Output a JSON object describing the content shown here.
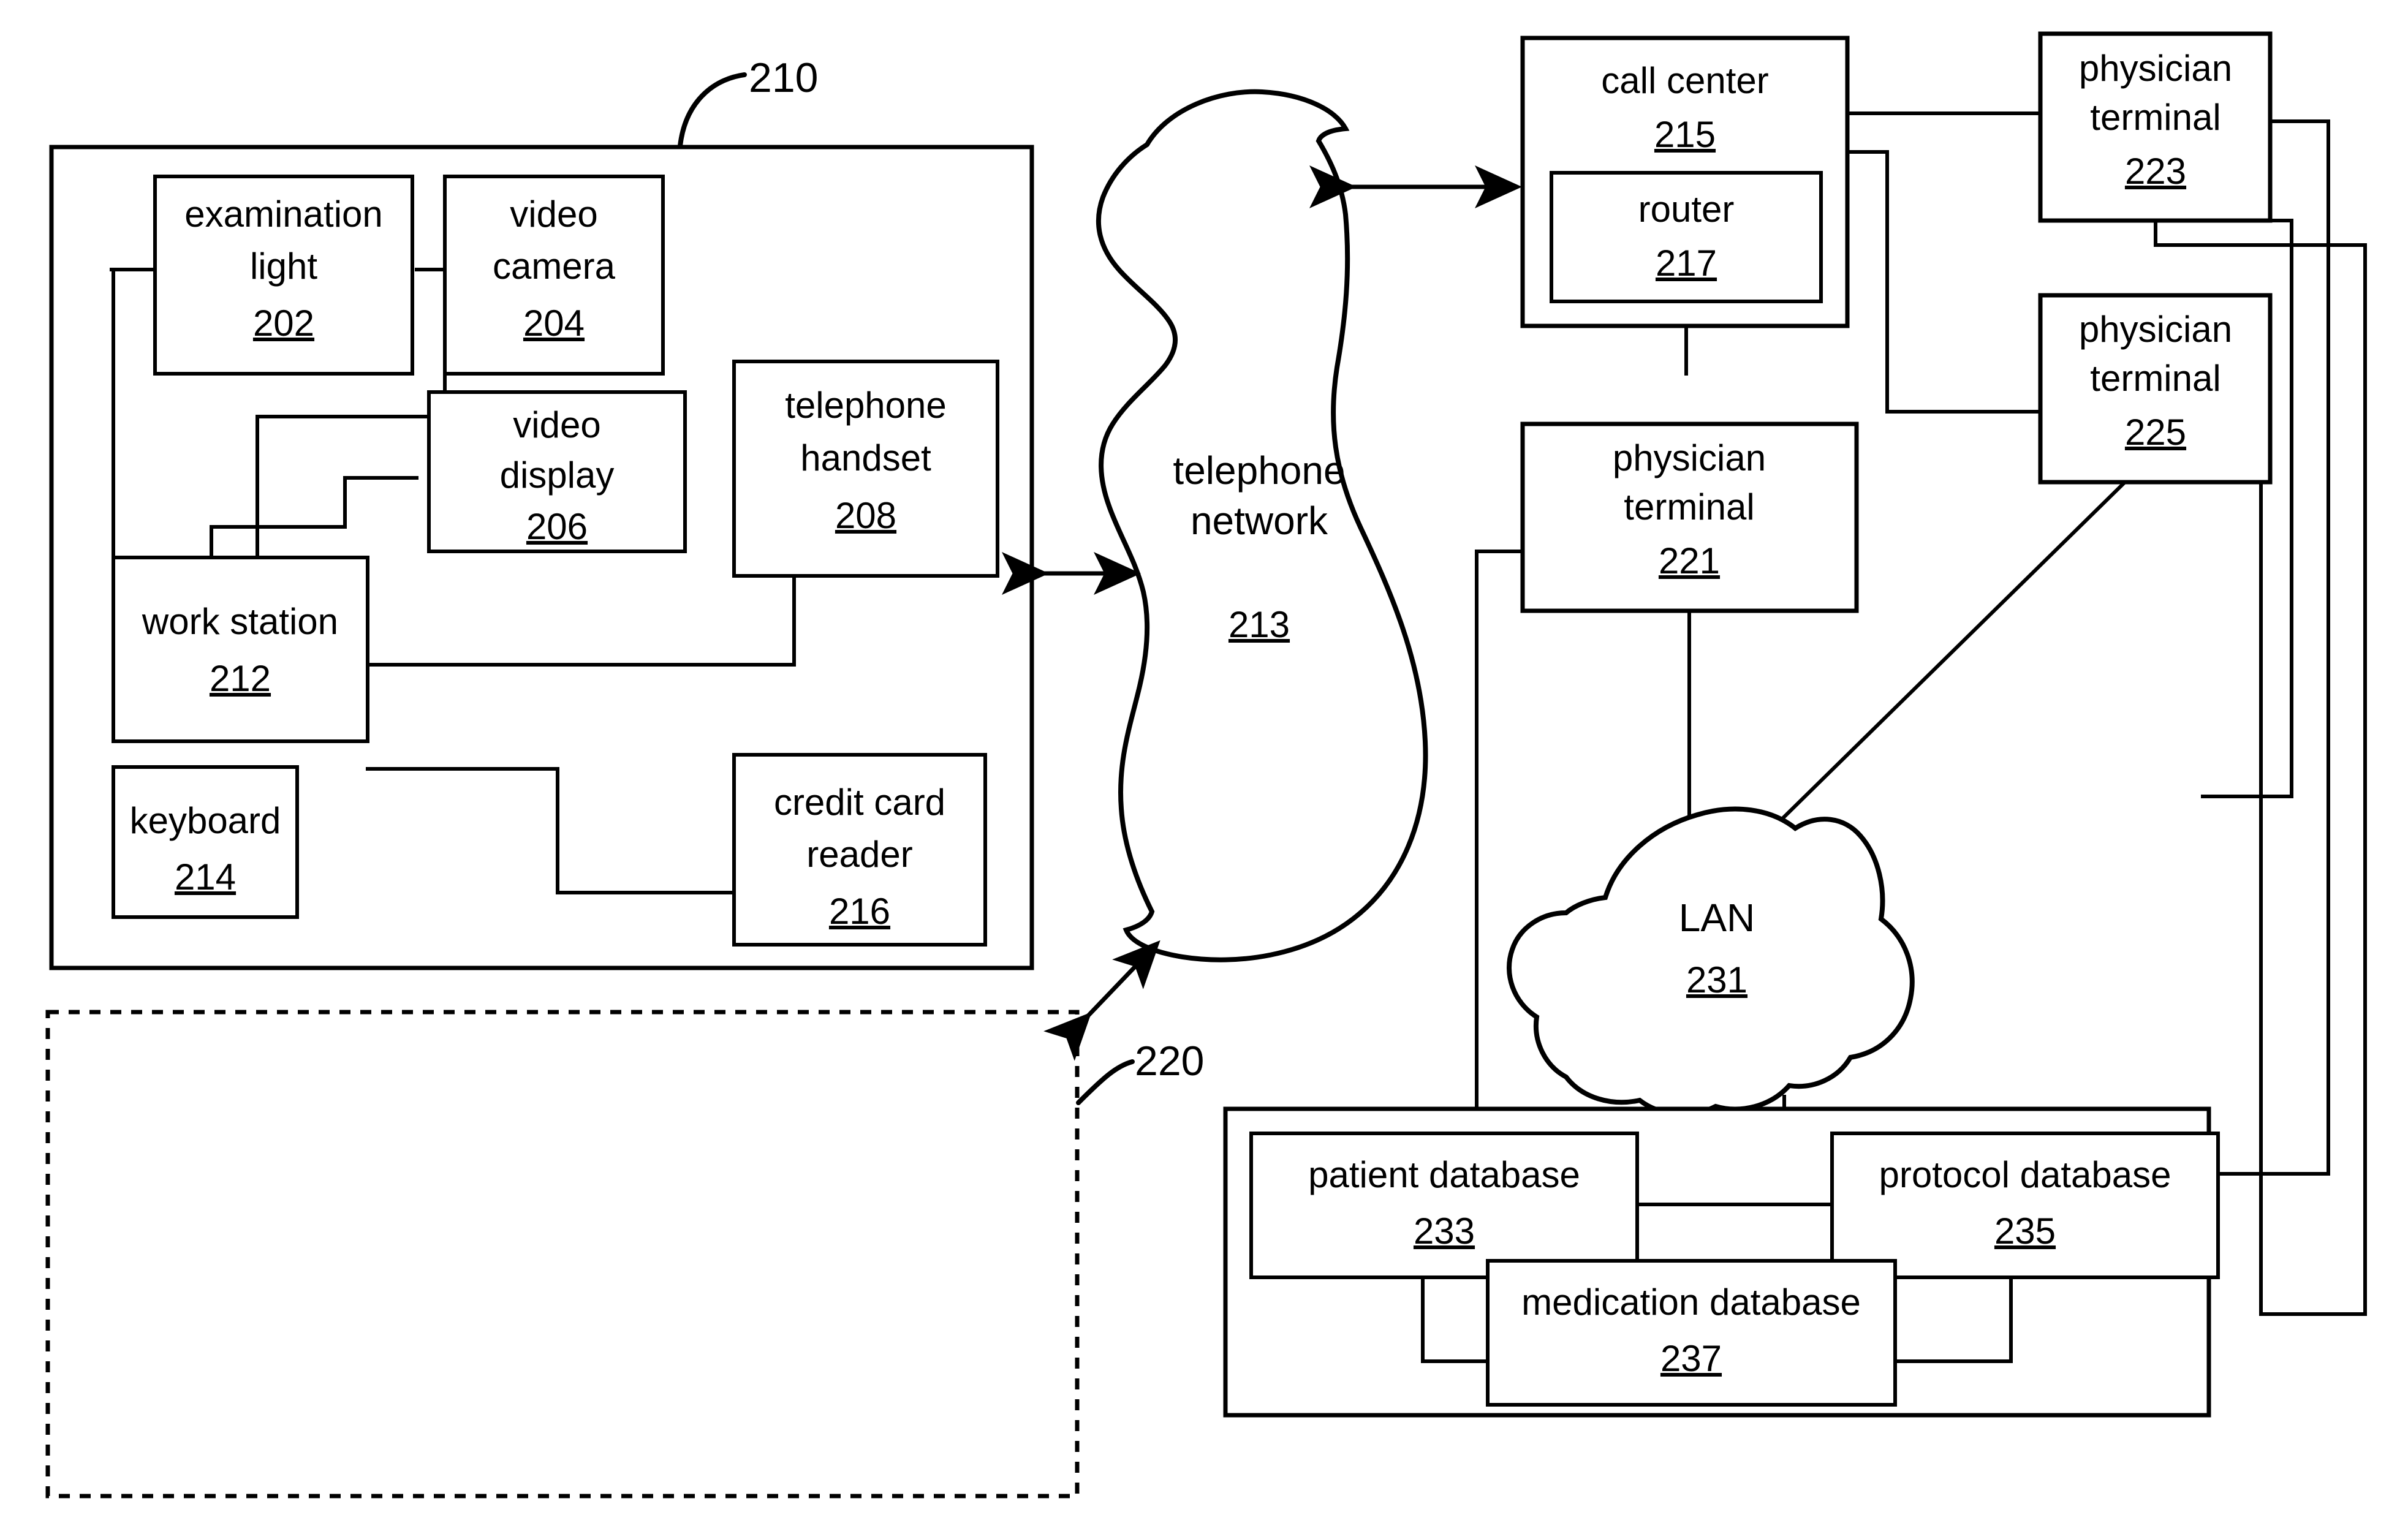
{
  "figure": {
    "type": "patent-block-diagram",
    "background": "#ffffff",
    "line_color": "#000000"
  },
  "reference_callouts": [
    {
      "id": "callout-210",
      "text": "210"
    },
    {
      "id": "callout-220",
      "text": "220"
    }
  ],
  "nodes": {
    "examination_light": {
      "label_line1": "examination",
      "label_line2": "light",
      "ref": "202"
    },
    "video_camera": {
      "label_line1": "video",
      "label_line2": "camera",
      "ref": "204"
    },
    "video_display": {
      "label_line1": "video",
      "label_line2": "display",
      "ref": "206"
    },
    "telephone_handset": {
      "label_line1": "telephone",
      "label_line2": "handset",
      "ref": "208"
    },
    "work_station": {
      "label_line1": "work station",
      "label_line2": "",
      "ref": "212"
    },
    "keyboard": {
      "label_line1": "keyboard",
      "label_line2": "",
      "ref": "214"
    },
    "credit_card_reader": {
      "label_line1": "credit card",
      "label_line2": "reader",
      "ref": "216"
    },
    "telephone_network": {
      "label_line1": "telephone",
      "label_line2": "network",
      "ref": "213"
    },
    "call_center": {
      "label_line1": "call center",
      "label_line2": "",
      "ref": "215"
    },
    "router": {
      "label_line1": "router",
      "label_line2": "",
      "ref": "217"
    },
    "physician_terminal_221": {
      "label_line1": "physician",
      "label_line2": "terminal",
      "ref": "221"
    },
    "physician_terminal_223": {
      "label_line1": "physician",
      "label_line2": "terminal",
      "ref": "223"
    },
    "physician_terminal_225": {
      "label_line1": "physician",
      "label_line2": "terminal",
      "ref": "225"
    },
    "lan": {
      "label_line1": "LAN",
      "label_line2": "",
      "ref": "231"
    },
    "patient_database": {
      "label_line1": "patient database",
      "label_line2": "",
      "ref": "233"
    },
    "protocol_database": {
      "label_line1": "protocol database",
      "label_line2": "",
      "ref": "235"
    },
    "medication_database": {
      "label_line1": "medication database",
      "label_line2": "",
      "ref": "237"
    }
  }
}
